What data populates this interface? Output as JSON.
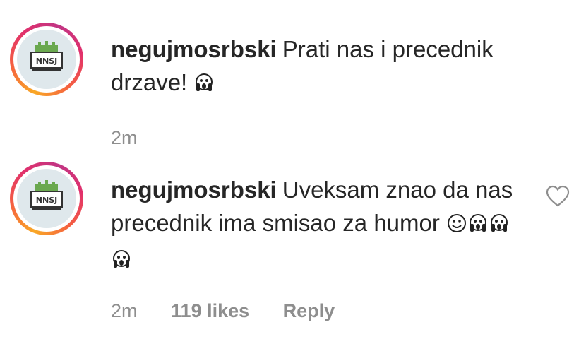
{
  "comments": [
    {
      "username": "negujmosrbski",
      "text": "Prati nas i precednik drzave!",
      "emojis": [
        "scream-emoji"
      ],
      "time": "2m"
    },
    {
      "username": "negujmosrbski",
      "text": "Uveksam znao da nas precednik ima smisao za humor",
      "emojis": [
        "smiley-emoji",
        "scream-emoji",
        "scream-emoji",
        "scream-emoji"
      ],
      "time": "2m",
      "likes": "119 likes",
      "reply": "Reply"
    }
  ],
  "avatar_logo_text": "NNS J",
  "colors": {
    "text": "#262626",
    "meta": "#8e8e8e",
    "story_ring_start": "#f9a826",
    "story_ring_end": "#c13584"
  },
  "icons": [
    "heart-icon"
  ]
}
